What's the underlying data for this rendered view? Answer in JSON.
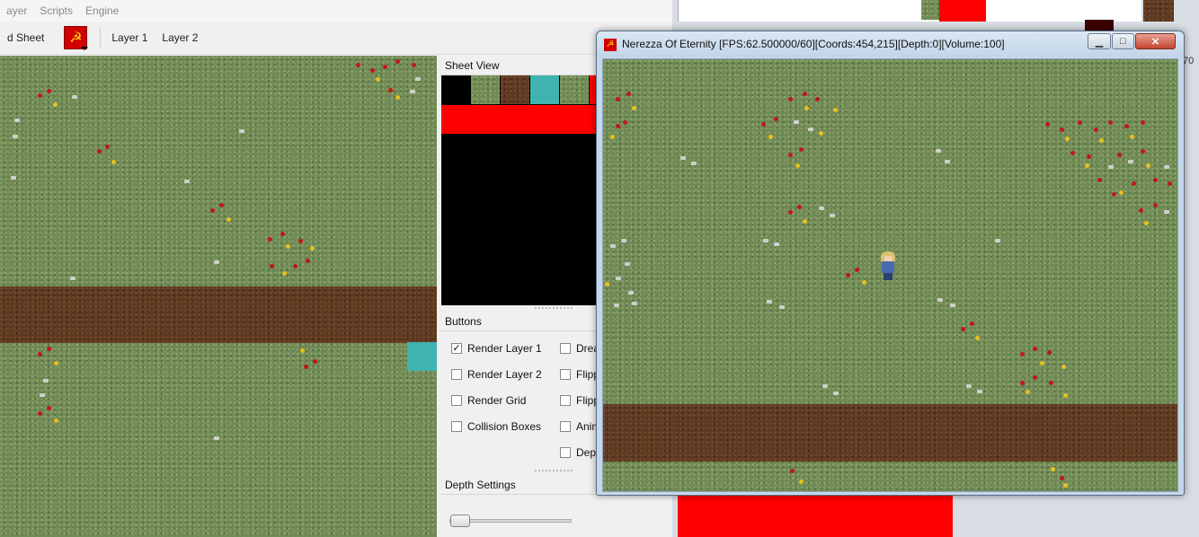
{
  "editor": {
    "menu": [
      "ayer",
      "Scripts",
      "Engine"
    ],
    "toolbar": {
      "sheet_button_label": "d Sheet",
      "layer1_label": "Layer 1",
      "layer2_label": "Layer 2"
    },
    "sheet_view": {
      "title": "Sheet View"
    },
    "buttons_panel": {
      "title": "Buttons",
      "left_column": [
        {
          "label": "Render Layer 1",
          "checked": true
        },
        {
          "label": "Render Layer 2",
          "checked": false
        },
        {
          "label": "Render Grid",
          "checked": false
        },
        {
          "label": "Collision Boxes",
          "checked": false
        }
      ],
      "right_column": [
        {
          "label": "Drea",
          "checked": false
        },
        {
          "label": "Flippi",
          "checked": false
        },
        {
          "label": "Flippi",
          "checked": false
        },
        {
          "label": "Anim",
          "checked": false
        },
        {
          "label": "Depti",
          "checked": false
        }
      ]
    },
    "depth_settings": {
      "title": "Depth Settings",
      "slider_value": 0
    }
  },
  "game_window": {
    "title": "Nerezza Of Eternity [FPS:62.500000/60][Coords:454,215][Depth:0][Volume:100]",
    "minimize_glyph": "▁",
    "maximize_glyph": "□",
    "close_glyph": "✕"
  },
  "background": {
    "edge_text": "70"
  },
  "icons": {
    "app_icon": "hammer-sickle-icon",
    "glyph": "☭"
  },
  "colors": {
    "grass": "#6f8a55",
    "dirt": "#5e3a22",
    "water": "#3fb3b0",
    "sheet_red": "#ff0000"
  }
}
